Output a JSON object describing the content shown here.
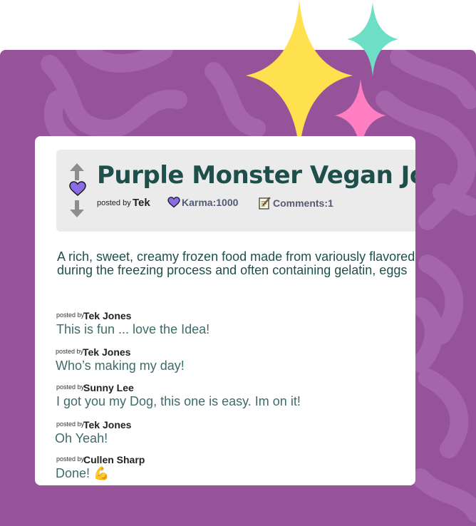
{
  "post": {
    "title": "Purple Monster Vegan Joy",
    "posted_by_label": "posted by",
    "author": "Tek",
    "karma": "Karma:1000",
    "comments": "Comments:1",
    "description_line1": "A rich, sweet, creamy frozen food made from variously flavored",
    "description_line2": "during the freezing process and often containing gelatin, eggs"
  },
  "comments": [
    {
      "posted_by": "posted by",
      "author": "Tek Jones",
      "text": "This is fun ... love the Idea!"
    },
    {
      "posted_by": "posted by",
      "author": "Tek Jones",
      "text": "Who’s making my day!"
    },
    {
      "posted_by": "posted by",
      "author": "Sunny Lee",
      "text": "I got you my Dog, this one is easy. Im on it!"
    },
    {
      "posted_by": "posted by",
      "author": "Tek Jones",
      "text": "Oh Yeah!"
    },
    {
      "posted_by": "posted by",
      "author": "Cullen Sharp",
      "text": "Done! 💪"
    }
  ],
  "colors": {
    "background_purple": "#965399",
    "title_teal": "#1f4f4b",
    "sparkle_yellow": "#ffe04f",
    "sparkle_teal": "#6ddfc6",
    "sparkle_pink": "#ff7ec3",
    "heart_purple": "#8b6be6"
  },
  "icons": [
    "arrow-up-icon",
    "heart-icon",
    "arrow-down-icon",
    "memo-icon",
    "flexed-biceps-icon",
    "sparkle-icon"
  ]
}
